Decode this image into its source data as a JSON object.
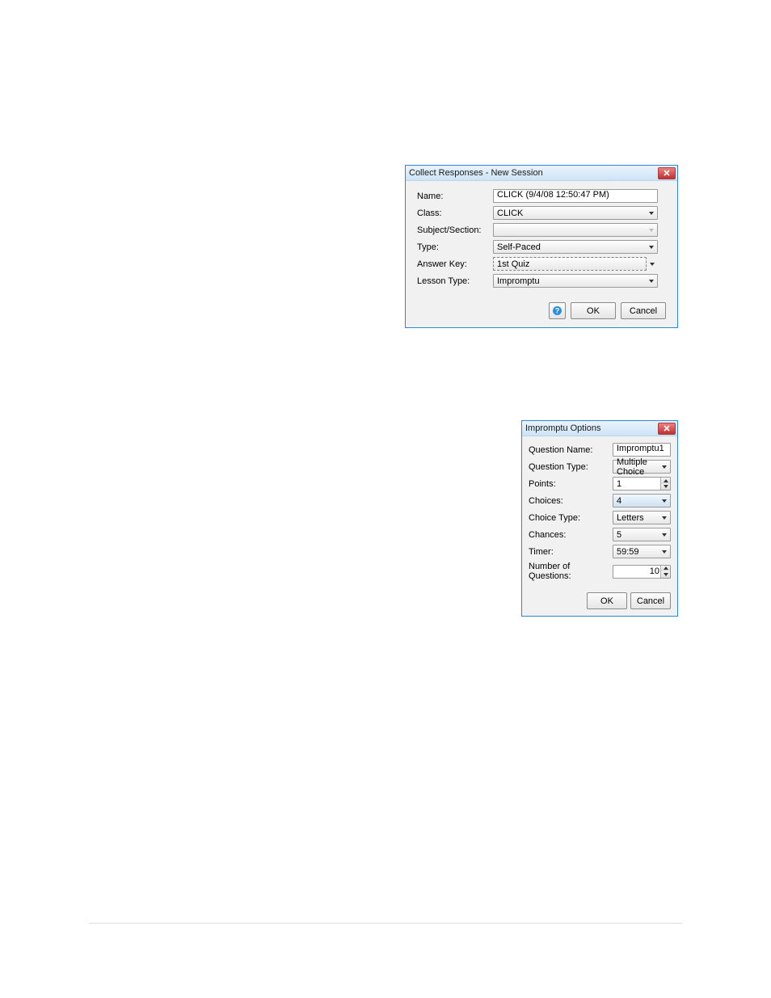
{
  "dialog1": {
    "title": "Collect Responses - New Session",
    "labels": {
      "name": "Name:",
      "class": "Class:",
      "subject": "Subject/Section:",
      "type": "Type:",
      "answerkey": "Answer Key:",
      "lessontype": "Lesson Type:"
    },
    "values": {
      "name": "CLICK (9/4/08 12:50:47 PM)",
      "class": "CLICK",
      "subject": "",
      "type": "Self-Paced",
      "answerkey": "1st Quiz",
      "lessontype": "Impromptu"
    },
    "buttons": {
      "ok": "OK",
      "cancel": "Cancel"
    }
  },
  "dialog2": {
    "title": "Impromptu Options",
    "labels": {
      "qname": "Question Name:",
      "qtype": "Question Type:",
      "points": "Points:",
      "choices": "Choices:",
      "choicetype": "Choice Type:",
      "chances": "Chances:",
      "timer": "Timer:",
      "numq": "Number of Questions:"
    },
    "values": {
      "qname": "Impromptu1",
      "qtype": "Multiple Choice",
      "points": "1",
      "choices": "4",
      "choicetype": "Letters",
      "chances": "5",
      "timer": "59:59",
      "numq": "10"
    },
    "buttons": {
      "ok": "OK",
      "cancel": "Cancel"
    }
  }
}
